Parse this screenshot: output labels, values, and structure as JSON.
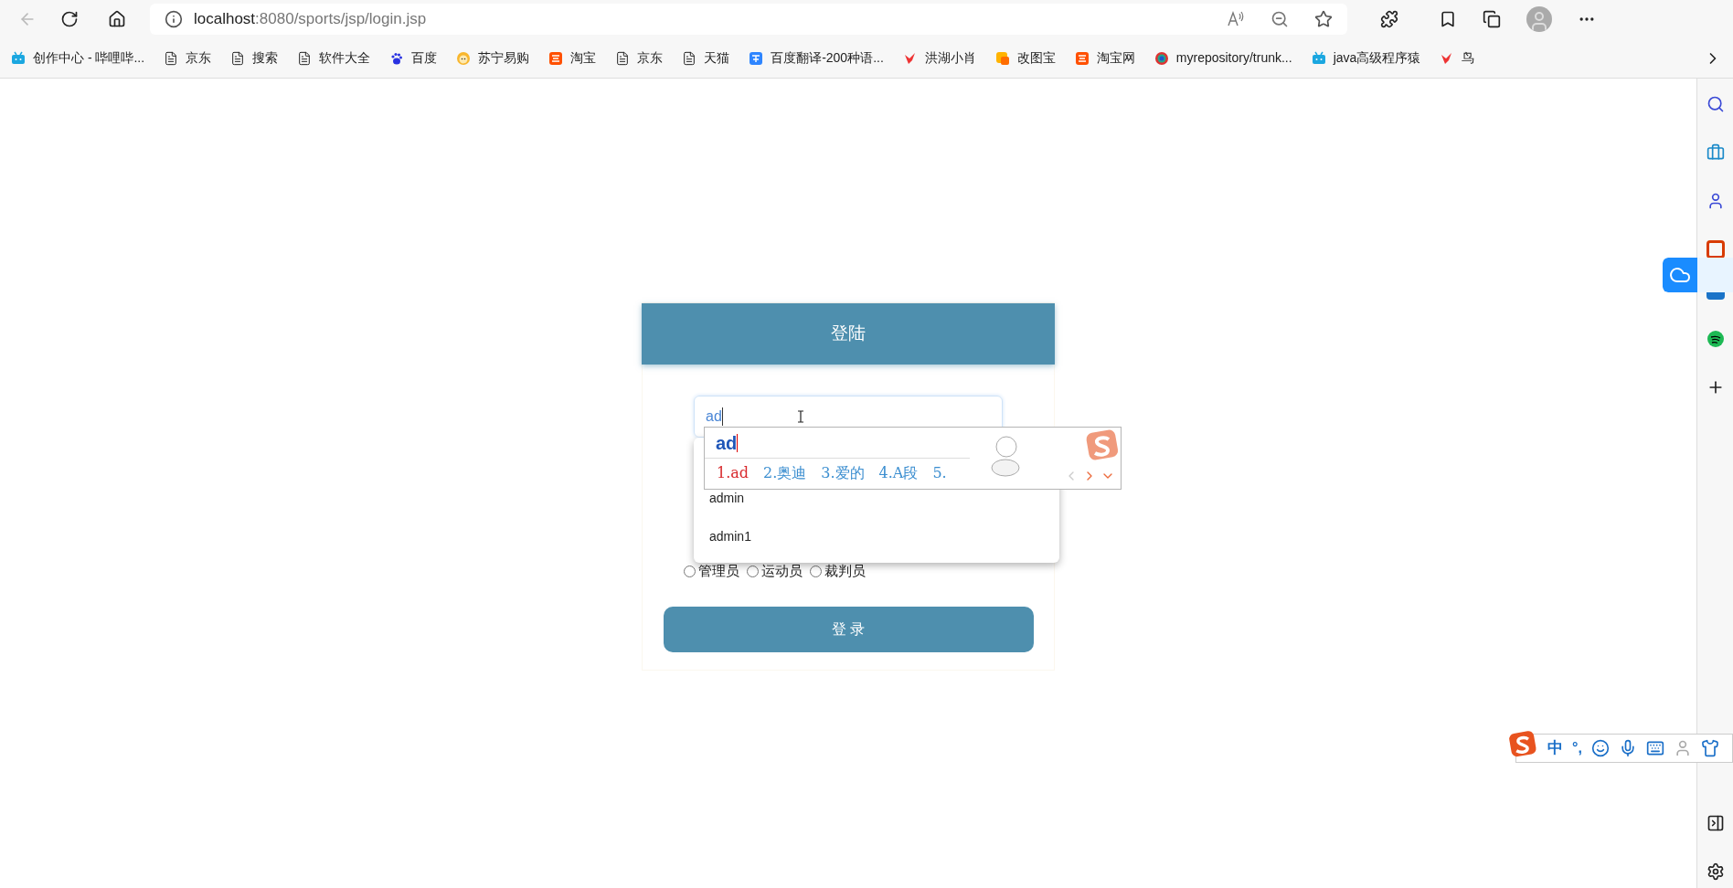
{
  "browser": {
    "url": {
      "host": "localhost",
      "path": ":8080/sports/jsp/login.jsp"
    },
    "bookmarks": [
      {
        "label": "创作中心 - 哔哩哔...",
        "kind": "tv"
      },
      {
        "label": "京东",
        "kind": "page"
      },
      {
        "label": "搜索",
        "kind": "page"
      },
      {
        "label": "软件大全",
        "kind": "page"
      },
      {
        "label": "百度",
        "kind": "paw"
      },
      {
        "label": "苏宁易购",
        "kind": "face"
      },
      {
        "label": "淘宝",
        "kind": "tao"
      },
      {
        "label": "京东",
        "kind": "page"
      },
      {
        "label": "天猫",
        "kind": "page"
      },
      {
        "label": "百度翻译-200种语...",
        "kind": "translate"
      },
      {
        "label": "洪湖小肖",
        "kind": "bird"
      },
      {
        "label": "改图宝",
        "kind": "square"
      },
      {
        "label": "淘宝网",
        "kind": "tao"
      },
      {
        "label": "myrepository/trunk...",
        "kind": "circle"
      },
      {
        "label": "java高级程序猿",
        "kind": "tv"
      },
      {
        "label": "鸟",
        "kind": "bird"
      }
    ]
  },
  "login": {
    "title": "登陆",
    "username": "ad",
    "suggestions": [
      "admin",
      "admin1"
    ],
    "roles": [
      {
        "label": "管理员",
        "selected": false
      },
      {
        "label": "运动员",
        "selected": false
      },
      {
        "label": "裁判员",
        "selected": false
      }
    ],
    "submit": "登 录"
  },
  "ime": {
    "composition": "ad",
    "candidates": [
      {
        "text": "1.ad",
        "selected": true
      },
      {
        "text": "2.奥迪",
        "selected": false
      },
      {
        "text": "3.爱的",
        "selected": false
      },
      {
        "text": "4.A段",
        "selected": false
      },
      {
        "text": "5.",
        "selected": false
      }
    ],
    "mode": "中",
    "punctuation": "°,"
  }
}
